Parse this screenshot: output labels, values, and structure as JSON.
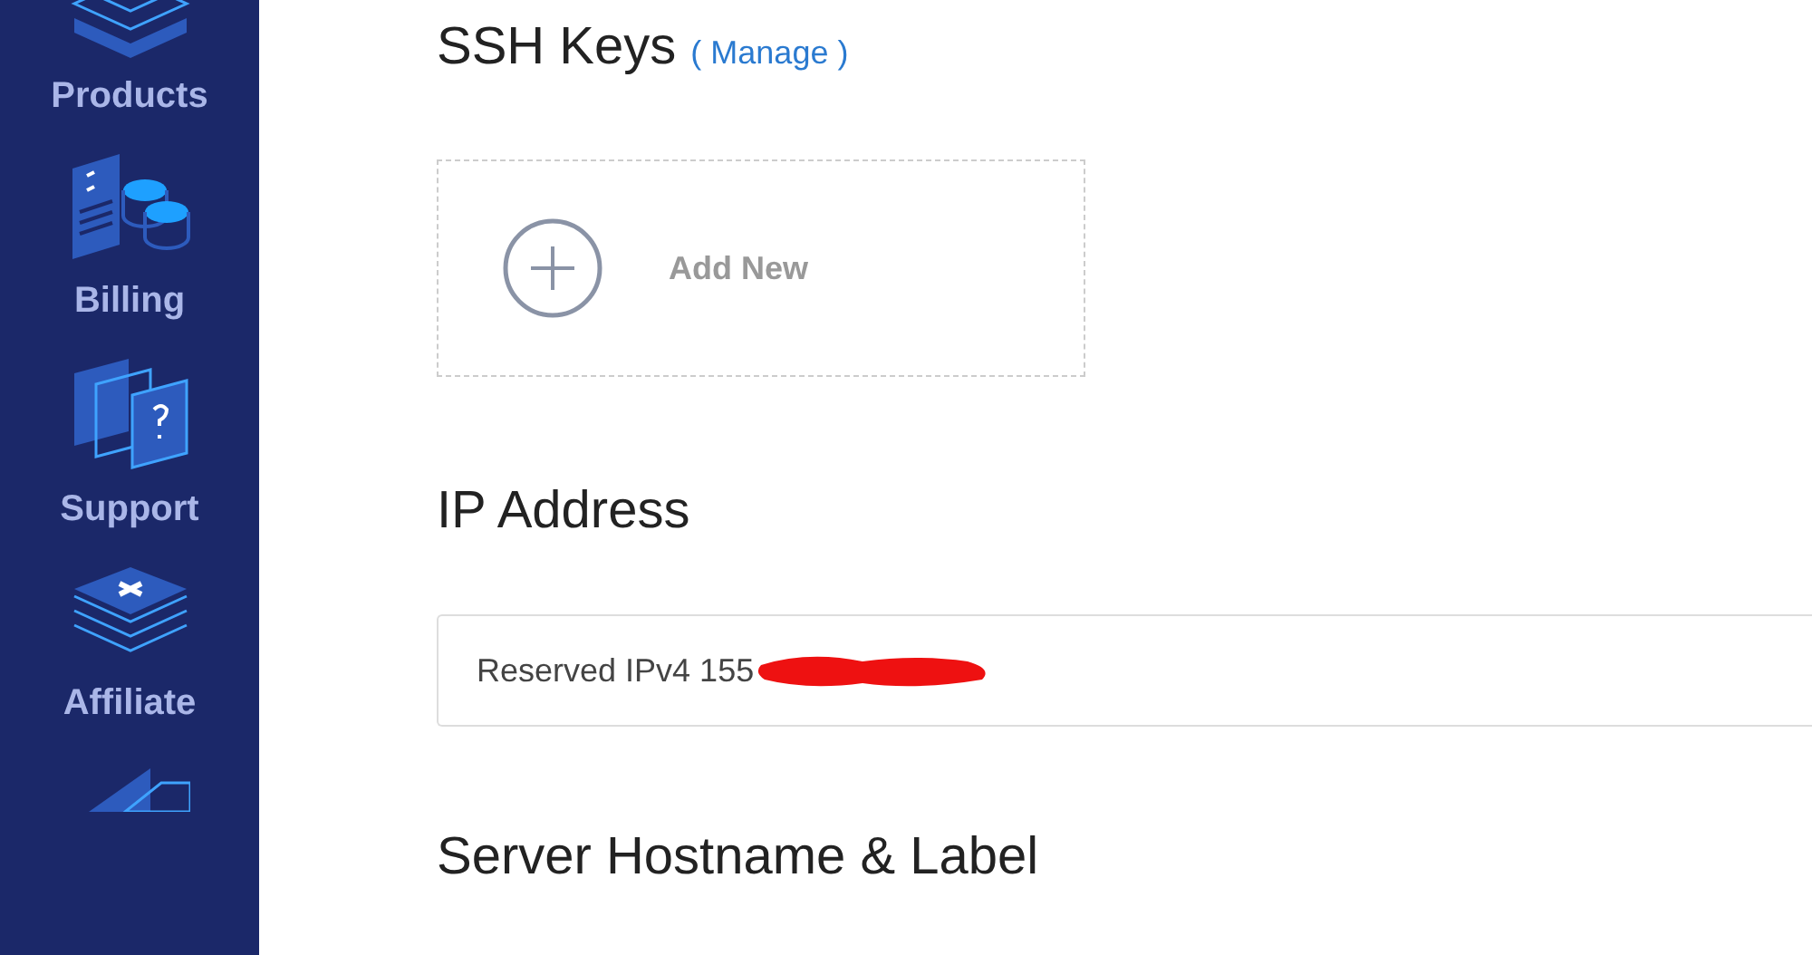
{
  "sidebar": {
    "items": [
      {
        "kind": "layers",
        "label": "Products"
      },
      {
        "kind": "billing",
        "label": "Billing"
      },
      {
        "kind": "support",
        "label": "Support"
      },
      {
        "kind": "affiliate",
        "label": "Affiliate"
      },
      {
        "kind": "more"
      }
    ]
  },
  "ssh_keys": {
    "title": "SSH Keys",
    "manage_link": "( Manage )",
    "add_card": {
      "label": "Add New"
    }
  },
  "ip_address": {
    "title": "IP Address",
    "value": "Reserved IPv4 155",
    "redacted": true
  },
  "hostname": {
    "title": "Server Hostname & Label"
  }
}
